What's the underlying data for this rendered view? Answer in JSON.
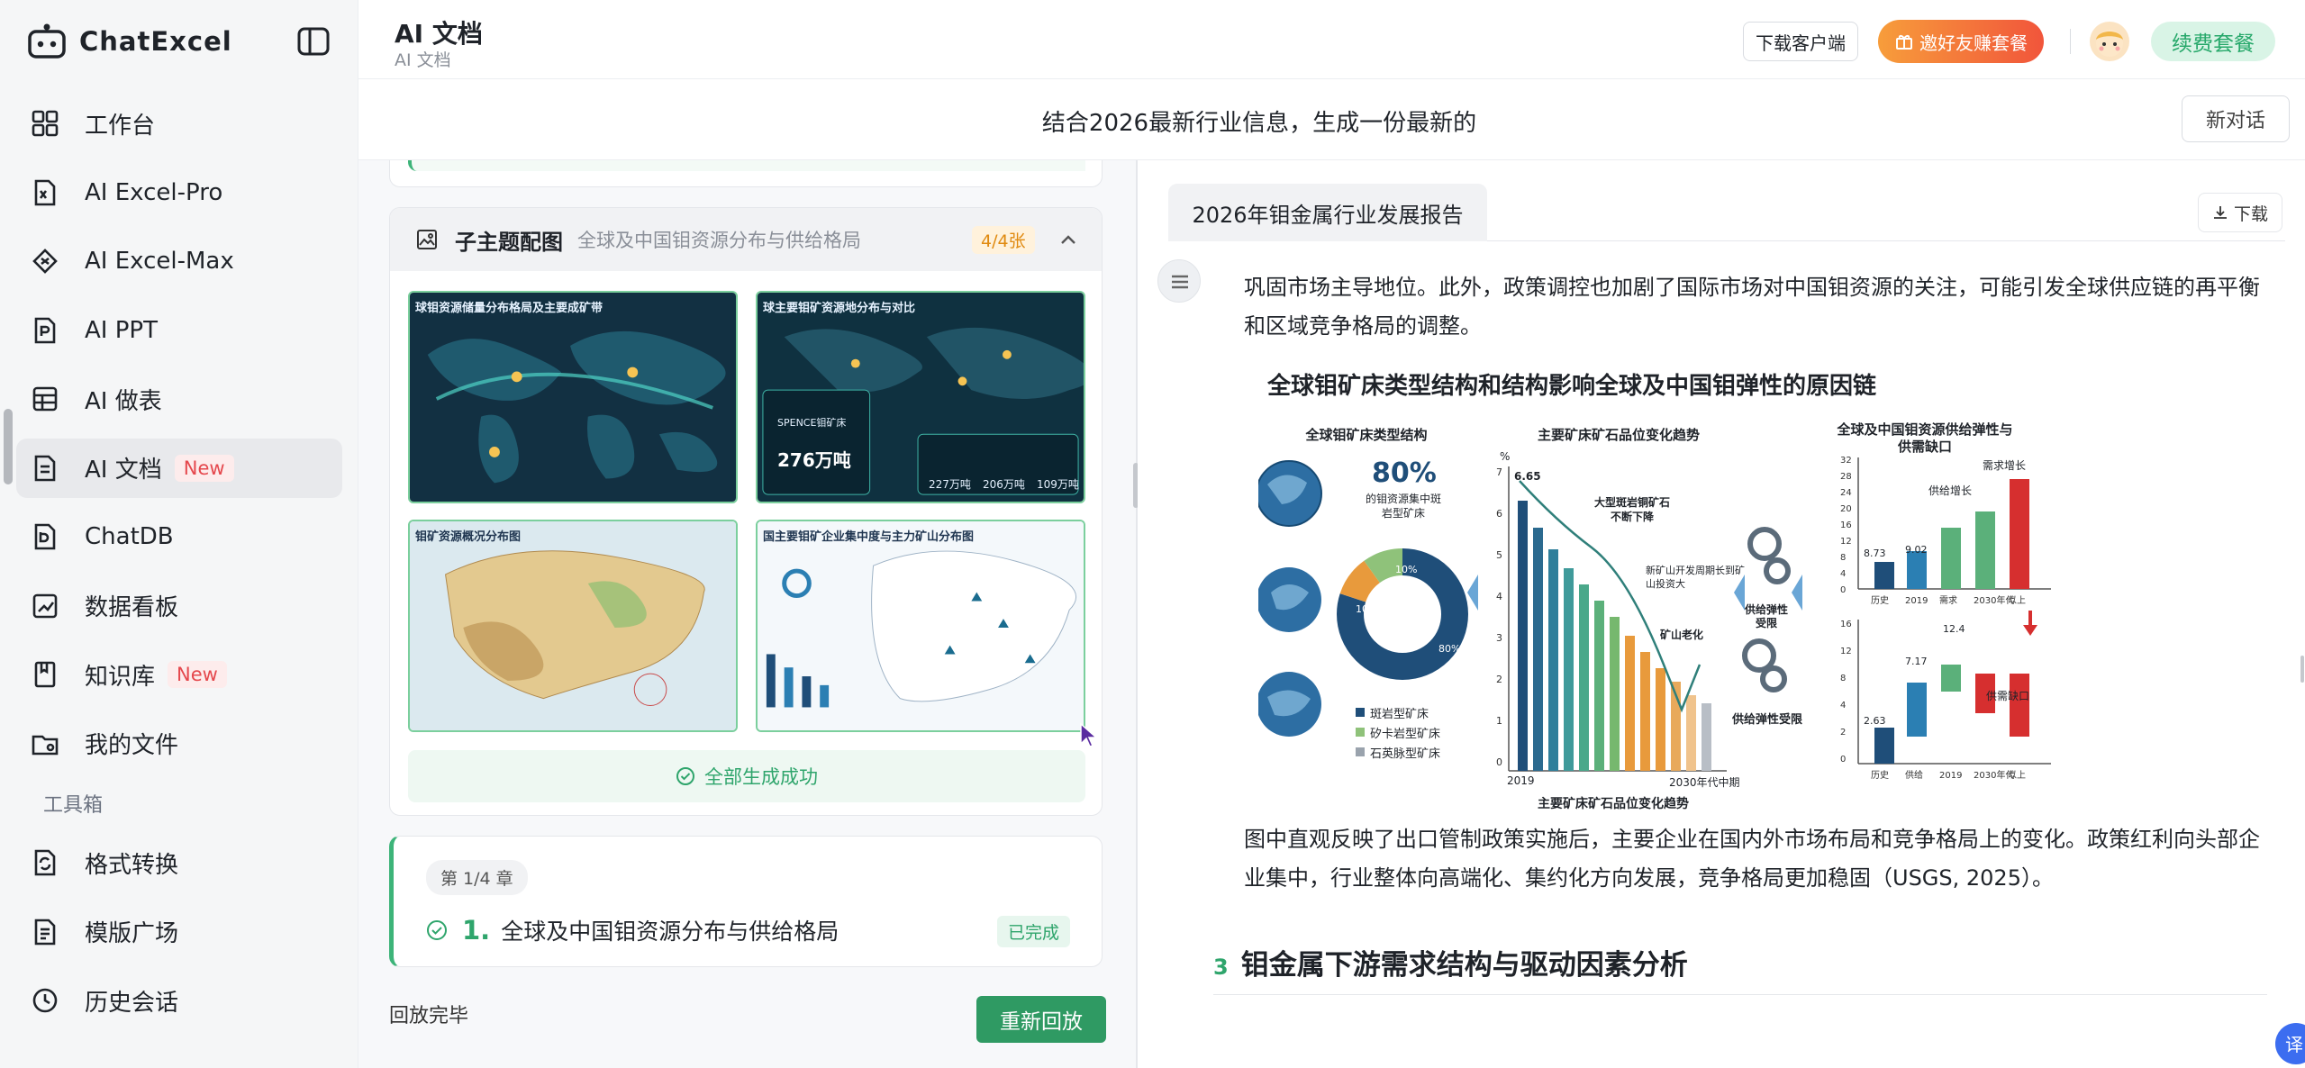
{
  "brand": {
    "name": "ChatExcel"
  },
  "sidebar": {
    "items": [
      {
        "label": "工作台",
        "icon": "grid-icon"
      },
      {
        "label": "AI Excel-Pro",
        "icon": "excel-pro-icon"
      },
      {
        "label": "AI Excel-Max",
        "icon": "excel-max-icon"
      },
      {
        "label": "AI PPT",
        "icon": "ppt-icon"
      },
      {
        "label": "AI 做表",
        "icon": "table-icon"
      },
      {
        "label": "AI 文档",
        "icon": "document-icon",
        "badge": "New",
        "active": true
      },
      {
        "label": "ChatDB",
        "icon": "database-icon"
      },
      {
        "label": "数据看板",
        "icon": "dashboard-icon"
      },
      {
        "label": "知识库",
        "icon": "knowledge-icon",
        "badge": "New"
      },
      {
        "label": "我的文件",
        "icon": "folder-icon"
      }
    ],
    "section_title": "工具箱",
    "tools": [
      {
        "label": "格式转换",
        "icon": "convert-icon"
      },
      {
        "label": "模版广场",
        "icon": "template-icon"
      },
      {
        "label": "历史会话",
        "icon": "history-icon"
      }
    ]
  },
  "header": {
    "title": "AI 文档",
    "subtitle": "AI 文档",
    "download_client": "下载客户端",
    "invite": "邀好友赚套餐",
    "renew": "续费套餐"
  },
  "conversation": {
    "title": "结合2026最新行业信息，生成一份最新的",
    "new_chat": "新对话"
  },
  "middle": {
    "topic": {
      "label": "子主题配图",
      "desc": "全球及中国钼资源分布与供给格局",
      "count": "4/4张"
    },
    "thumbs": [
      {
        "title": "球钼资源储量分布格局及主要成矿带"
      },
      {
        "title": "球主要钼矿资源地分布与对比"
      },
      {
        "title": "钼矿资源概况分布图"
      },
      {
        "title": "国主要钼矿企业集中度与主力矿山分布图"
      }
    ],
    "thumb_text": {
      "spence": "SPENCE钼矿床",
      "amount": "276万吨",
      "stats": [
        "227万吨",
        "206万吨",
        "109万吨"
      ]
    },
    "done_text": "全部生成成功",
    "chapter": {
      "tag": "第 1/4 章",
      "num": "1.",
      "title": "全球及中国钼资源分布与供给格局",
      "status": "已完成"
    },
    "replay_text": "回放完毕",
    "replay_button": "重新回放"
  },
  "document": {
    "tab": "2026年钼金属行业发展报告",
    "download": "下载",
    "para1": "巩固市场主导地位。此外，政策调控也加剧了国际市场对中国钼资源的关注，可能引发全球供应链的再平衡和区域竞争格局的调整。",
    "figure": {
      "title": "全球钼矿床类型结构和结构影响全球及中国钼弹性的原因链",
      "panel1_title": "全球钼矿床类型结构",
      "panel2_title": "主要矿床矿石品位变化趋势",
      "panel3_title": "全球及中国钼资源供给弹性与供需缺口",
      "big_pct": "80%",
      "big_pct_caption": "的钼资源集中斑岩型矿床",
      "donut": [
        "10%",
        "10%",
        "80%"
      ],
      "legend": [
        "斑岩型矿床",
        "矽卡岩型矿床",
        "石英脉型矿床"
      ],
      "trend_annot": [
        "大型斑岩铜矿石不断下降",
        "新矿山开发周期长到矿山投资大",
        "矿山老化"
      ],
      "trend_axis": {
        "unit": "%",
        "start": "2019",
        "end": "2030年代中期",
        "first": "6.65"
      },
      "trend_xlabel": "主要矿床矿石品位变化趋势",
      "flow_labels": [
        "供给弹性受限",
        "供给弹性受限"
      ],
      "top_bars": {
        "cats": [
          "历史",
          "2019",
          "需求",
          "2030年代",
          "以上"
        ],
        "vals": [
          "8.73",
          "9.02"
        ],
        "notes": [
          "供给增长",
          "需求增长"
        ]
      },
      "bottom_bars": {
        "cats": [
          "历史",
          "供给",
          "2019",
          "2030年代",
          "以上"
        ],
        "vals": [
          "2.63",
          "7.17",
          "12.4"
        ],
        "notes": [
          "供需缺口"
        ]
      },
      "top_ticks": [
        "32",
        "28",
        "24",
        "20",
        "16",
        "12",
        "8",
        "4",
        "0"
      ],
      "bottom_ticks": [
        "16",
        "12",
        "8",
        "4",
        "2",
        "0"
      ],
      "trend_ticks": [
        "7",
        "6",
        "5",
        "4",
        "3",
        "2",
        "1",
        "0"
      ]
    },
    "para2": "图中直观反映了出口管制政策实施后，主要企业在国内外市场布局和竞争格局上的变化。政策红利向头部企业集中，行业整体向高端化、集约化方向发展，竞争格局更加稳固（USGS, 2025）。",
    "heading_num": "3",
    "heading": "钼金属下游需求结构与驱动因素分析",
    "translate": "译"
  },
  "colors": {
    "accent_green": "#2fa56c",
    "sidebar_bg": "#f5f6f7",
    "badge_red": "#e5484d",
    "invite_orange": "#f1553b",
    "chart_navy": "#1f4e79",
    "chart_red": "#d62f2f"
  }
}
